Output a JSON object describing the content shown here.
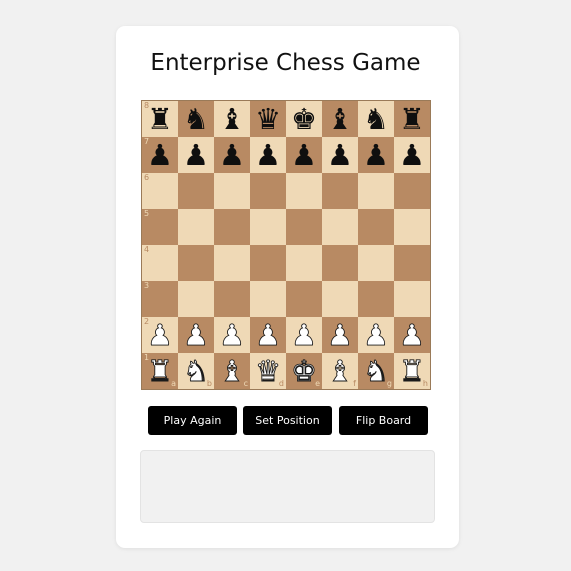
{
  "title": "Enterprise Chess Game",
  "board": {
    "files": [
      "a",
      "b",
      "c",
      "d",
      "e",
      "f",
      "g",
      "h"
    ],
    "ranks": [
      "8",
      "7",
      "6",
      "5",
      "4",
      "3",
      "2",
      "1"
    ],
    "colors": {
      "light": "#efd9b6",
      "dark": "#b88a63"
    },
    "position": [
      [
        "bR",
        "bN",
        "bB",
        "bQ",
        "bK",
        "bB",
        "bN",
        "bR"
      ],
      [
        "bP",
        "bP",
        "bP",
        "bP",
        "bP",
        "bP",
        "bP",
        "bP"
      ],
      [
        "",
        "",
        "",
        "",
        "",
        "",
        "",
        ""
      ],
      [
        "",
        "",
        "",
        "",
        "",
        "",
        "",
        ""
      ],
      [
        "",
        "",
        "",
        "",
        "",
        "",
        "",
        ""
      ],
      [
        "",
        "",
        "",
        "",
        "",
        "",
        "",
        ""
      ],
      [
        "wP",
        "wP",
        "wP",
        "wP",
        "wP",
        "wP",
        "wP",
        "wP"
      ],
      [
        "wR",
        "wN",
        "wB",
        "wQ",
        "wK",
        "wB",
        "wN",
        "wR"
      ]
    ]
  },
  "buttons": {
    "play_again": "Play Again",
    "set_position": "Set Position",
    "flip_board": "Flip Board"
  },
  "output": {
    "text": ""
  }
}
